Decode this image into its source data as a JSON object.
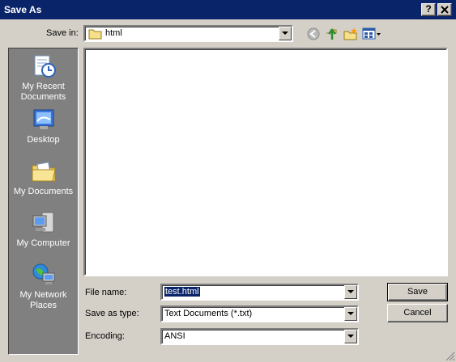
{
  "window": {
    "title": "Save As",
    "help_label": "?",
    "close_label": "✕"
  },
  "save_in": {
    "label": "Save in:",
    "value": "html"
  },
  "places": [
    {
      "label_line1": "My Recent",
      "label_line2": "Documents",
      "icon": "recent-documents-icon"
    },
    {
      "label_line1": "Desktop",
      "label_line2": "",
      "icon": "desktop-icon"
    },
    {
      "label_line1": "My Documents",
      "label_line2": "",
      "icon": "my-documents-icon"
    },
    {
      "label_line1": "My Computer",
      "label_line2": "",
      "icon": "my-computer-icon"
    },
    {
      "label_line1": "My Network",
      "label_line2": "Places",
      "icon": "network-places-icon"
    }
  ],
  "fields": {
    "file_name_label": "File name:",
    "file_name_value": "test.html",
    "save_as_type_label": "Save as type:",
    "save_as_type_value": "Text Documents (*.txt)",
    "encoding_label": "Encoding:",
    "encoding_value": "ANSI"
  },
  "buttons": {
    "save": "Save",
    "cancel": "Cancel"
  },
  "colors": {
    "titlebar": "#0a246a",
    "dialog": "#d4d0c8",
    "places_bar": "#808080",
    "selection": "#0a246a"
  }
}
